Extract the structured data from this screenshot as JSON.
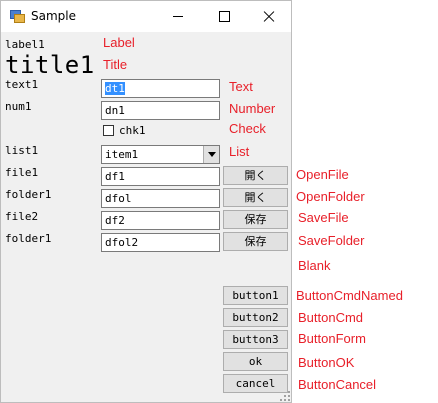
{
  "window": {
    "title": "Sample"
  },
  "form": {
    "label1": "label1",
    "title1": "title1",
    "text1": {
      "label": "text1",
      "value": "dt1"
    },
    "num1": {
      "label": "num1",
      "value": "dn1"
    },
    "chk1": {
      "label": "chk1",
      "checked": false
    },
    "list1": {
      "label": "list1",
      "selected": "item1"
    },
    "file1": {
      "label": "file1",
      "value": "df1",
      "button": "開く"
    },
    "folder1": {
      "label": "folder1",
      "value": "dfol",
      "button": "開く"
    },
    "file2": {
      "label": "file2",
      "value": "df2",
      "button": "保存"
    },
    "folder2": {
      "label": "folder1",
      "value": "dfol2",
      "button": "保存"
    },
    "buttons": [
      "button1",
      "button2",
      "button3",
      "ok",
      "cancel"
    ]
  },
  "annotations": {
    "label": "Label",
    "title": "Title",
    "text": "Text",
    "number": "Number",
    "check": "Check",
    "list": "List",
    "open_file": "OpenFile",
    "open_folder": "OpenFolder",
    "save_file": "SaveFile",
    "save_folder": "SaveFolder",
    "blank": "Blank",
    "button_cmd_named": "ButtonCmdNamed",
    "button_cmd": "ButtonCmd",
    "button_form": "ButtonForm",
    "button_ok": "ButtonOK",
    "button_cancel": "ButtonCancel"
  },
  "colors": {
    "annotation": "#e8202a",
    "selection": "#3390ff"
  }
}
